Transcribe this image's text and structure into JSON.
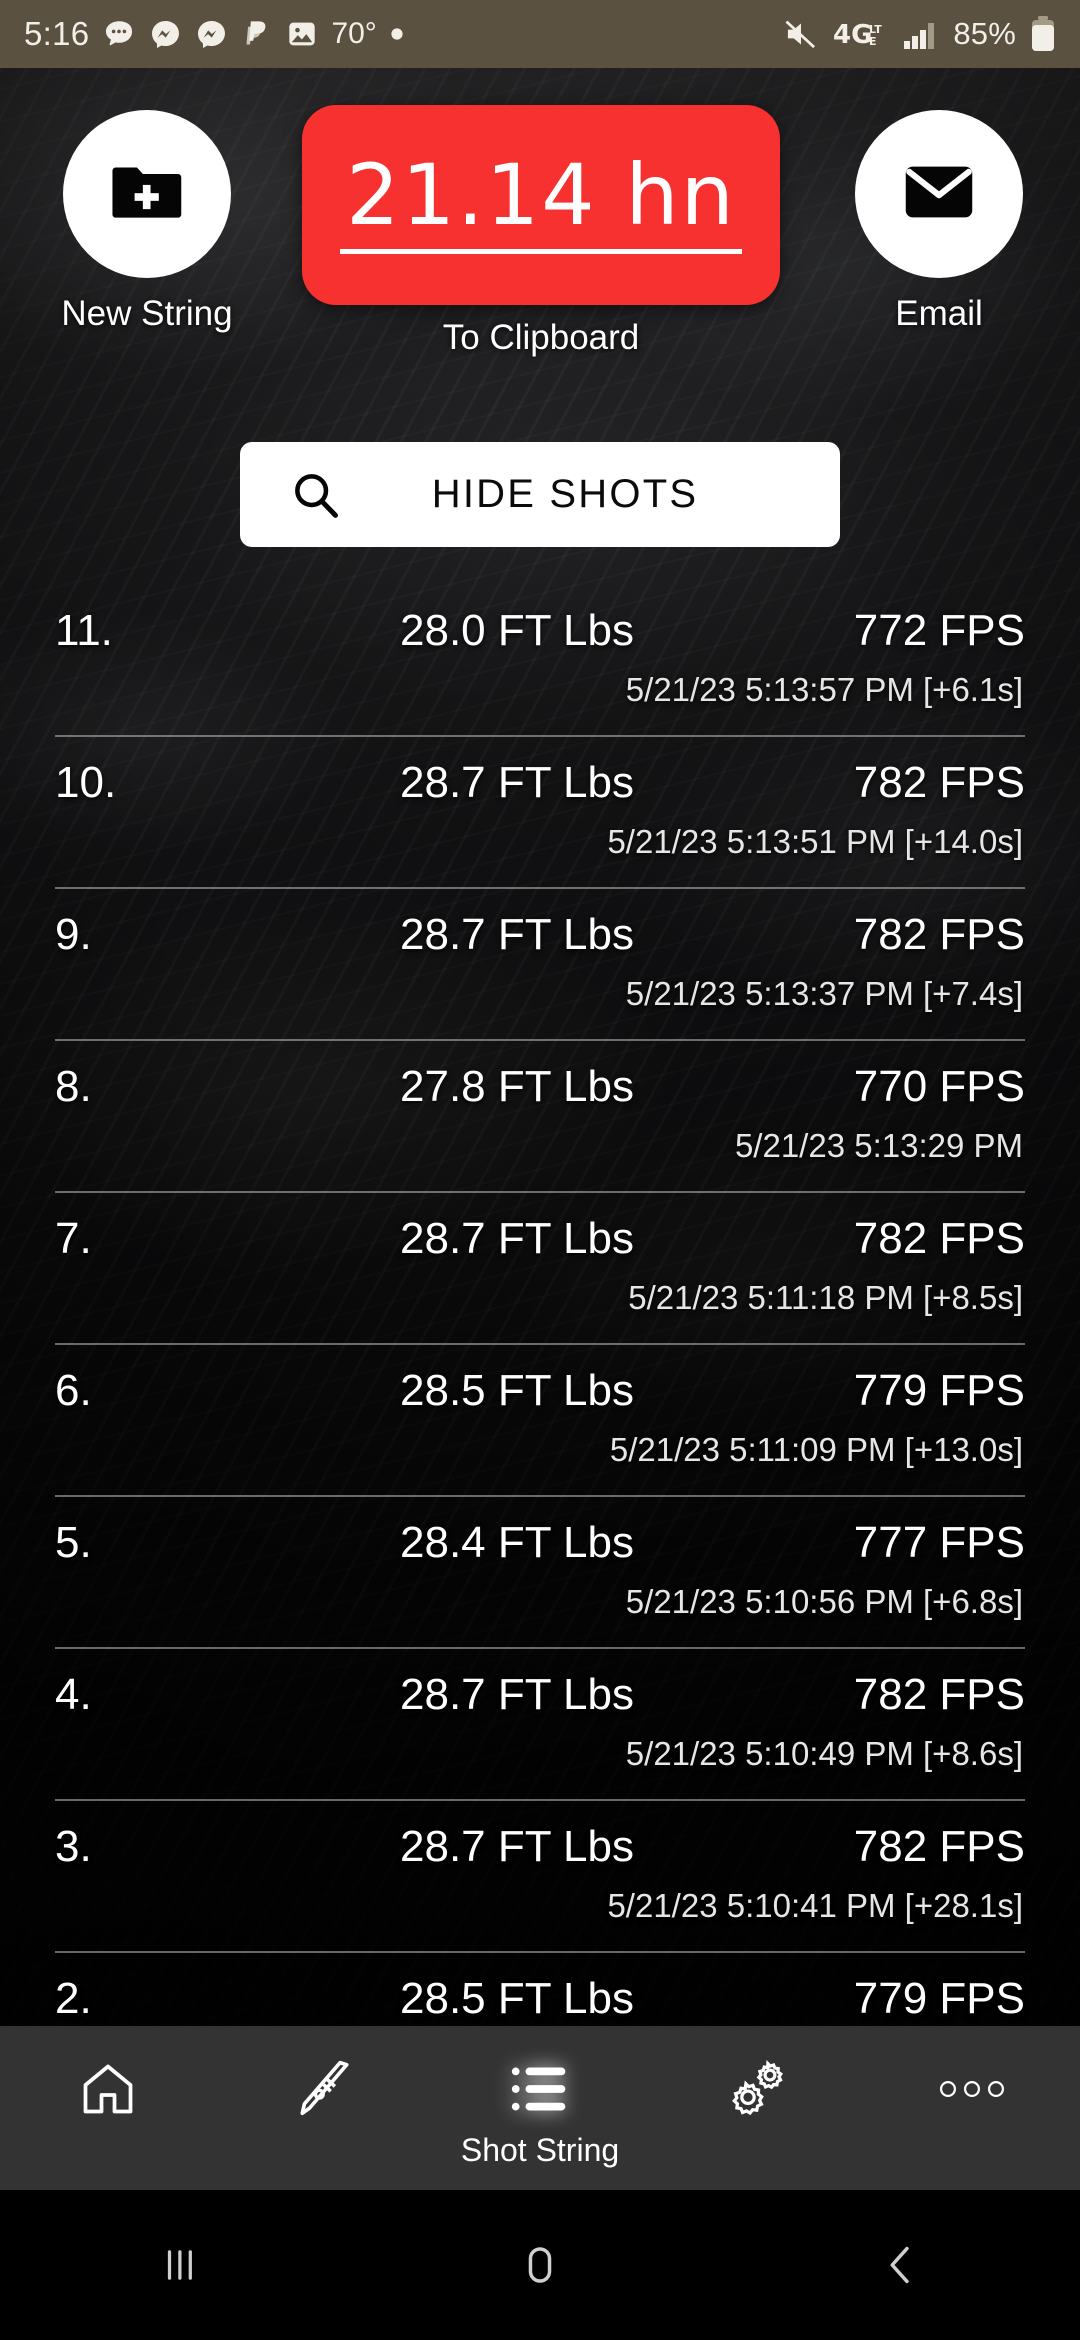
{
  "status_bar": {
    "time": "5:16",
    "temperature": "70°",
    "battery": "85%",
    "network": "4G LTE",
    "icons": [
      "sms-bubble-icon",
      "messenger-icon",
      "messenger-icon",
      "paypal-icon",
      "photo-icon",
      "dot-icon",
      "mute-icon",
      "signal-icon",
      "battery-icon"
    ],
    "background_color": "#5b5140"
  },
  "top_actions": {
    "new_string_label": "New String",
    "email_label": "Email",
    "clipboard_value": "21.14 hn",
    "clipboard_label": "To Clipboard",
    "clipboard_color": "#f7312f"
  },
  "hide_shots": {
    "label": "HIDE SHOTS"
  },
  "shots": [
    {
      "index": "11.",
      "energy": "28.0 FT Lbs",
      "speed": "772 FPS",
      "stamp": "5/21/23 5:13:57 PM [+6.1s]"
    },
    {
      "index": "10.",
      "energy": "28.7 FT Lbs",
      "speed": "782 FPS",
      "stamp": "5/21/23 5:13:51 PM [+14.0s]"
    },
    {
      "index": "9.",
      "energy": "28.7 FT Lbs",
      "speed": "782 FPS",
      "stamp": "5/21/23 5:13:37 PM [+7.4s]"
    },
    {
      "index": "8.",
      "energy": "27.8 FT Lbs",
      "speed": "770 FPS",
      "stamp": "5/21/23 5:13:29 PM"
    },
    {
      "index": "7.",
      "energy": "28.7 FT Lbs",
      "speed": "782 FPS",
      "stamp": "5/21/23 5:11:18 PM [+8.5s]"
    },
    {
      "index": "6.",
      "energy": "28.5 FT Lbs",
      "speed": "779 FPS",
      "stamp": "5/21/23 5:11:09 PM [+13.0s]"
    },
    {
      "index": "5.",
      "energy": "28.4 FT Lbs",
      "speed": "777 FPS",
      "stamp": "5/21/23 5:10:56 PM [+6.8s]"
    },
    {
      "index": "4.",
      "energy": "28.7 FT Lbs",
      "speed": "782 FPS",
      "stamp": "5/21/23 5:10:49 PM [+8.6s]"
    },
    {
      "index": "3.",
      "energy": "28.7 FT Lbs",
      "speed": "782 FPS",
      "stamp": "5/21/23 5:10:41 PM [+28.1s]"
    },
    {
      "index": "2.",
      "energy": "28.5 FT Lbs",
      "speed": "779 FPS",
      "stamp": ""
    }
  ],
  "bottom_nav": {
    "background_color": "#333333",
    "items": [
      {
        "label": "",
        "icon": "home-icon"
      },
      {
        "label": "",
        "icon": "rifle-icon"
      },
      {
        "label": "Shot String",
        "icon": "list-icon"
      },
      {
        "label": "",
        "icon": "gears-icon"
      },
      {
        "label": "",
        "icon": "more-dots-icon"
      }
    ],
    "active_index": 2
  },
  "system_nav": {
    "buttons": [
      "recents-icon",
      "home-icon",
      "back-icon"
    ]
  }
}
